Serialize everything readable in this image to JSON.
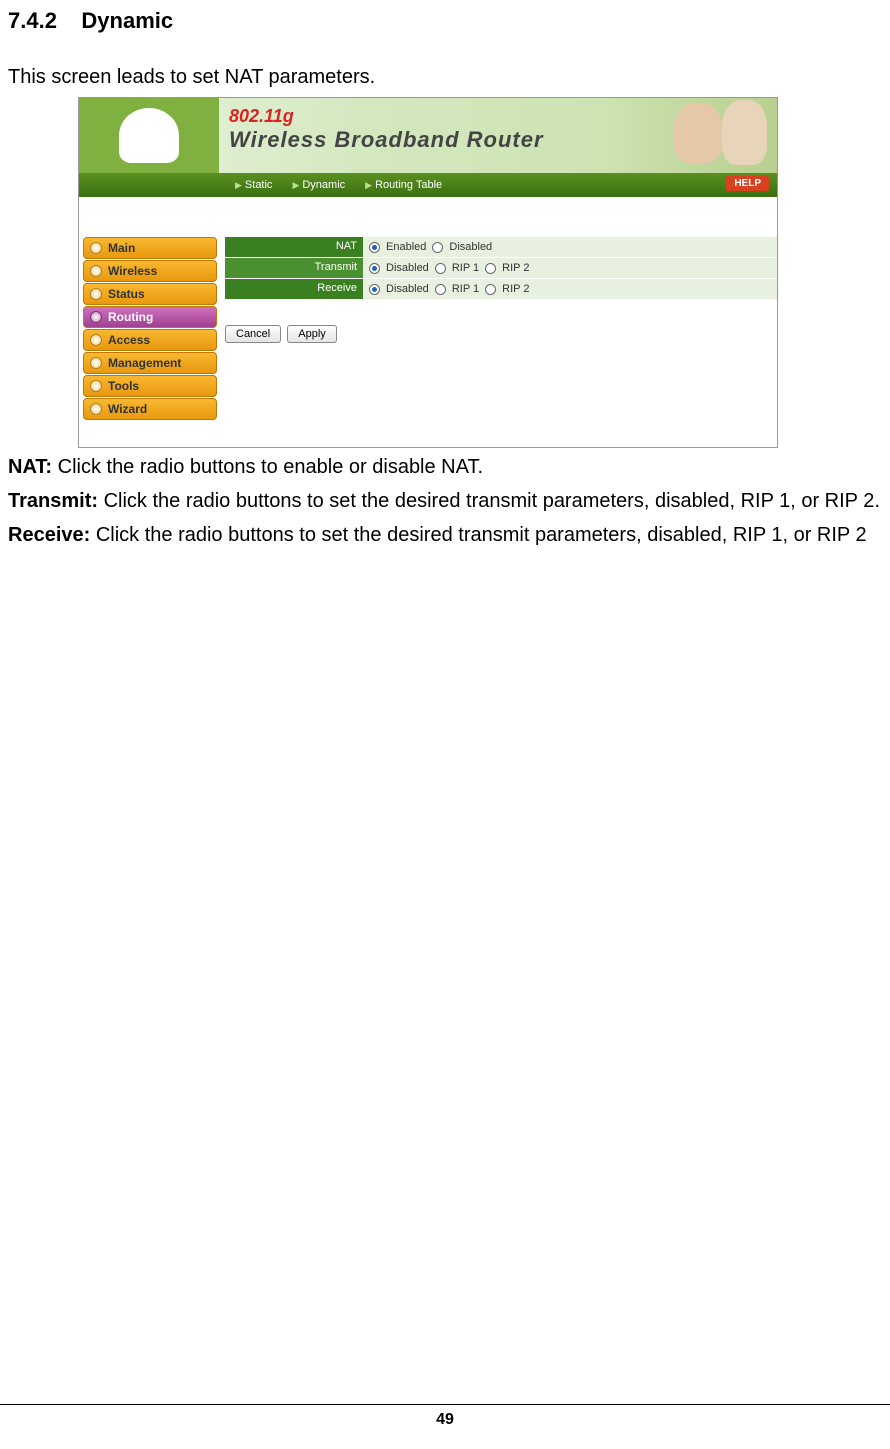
{
  "heading": {
    "number": "7.4.2",
    "title": "Dynamic"
  },
  "intro": "This screen leads to set NAT parameters.",
  "banner": {
    "logo": "802.11g",
    "title": "Wireless Broadband Router"
  },
  "subnav": {
    "items": [
      "Static",
      "Dynamic",
      "Routing Table"
    ],
    "help": "HELP"
  },
  "sidebar": {
    "items": [
      {
        "label": "Main",
        "active": false
      },
      {
        "label": "Wireless",
        "active": false
      },
      {
        "label": "Status",
        "active": false
      },
      {
        "label": "Routing",
        "active": true
      },
      {
        "label": "Access",
        "active": false
      },
      {
        "label": "Management",
        "active": false
      },
      {
        "label": "Tools",
        "active": false
      },
      {
        "label": "Wizard",
        "active": false
      }
    ]
  },
  "form": {
    "rows": [
      {
        "label": "NAT",
        "options": [
          "Enabled",
          "Disabled"
        ],
        "selected": 0
      },
      {
        "label": "Transmit",
        "options": [
          "Disabled",
          "RIP 1",
          "RIP 2"
        ],
        "selected": 0
      },
      {
        "label": "Receive",
        "options": [
          "Disabled",
          "RIP 1",
          "RIP 2"
        ],
        "selected": 0
      }
    ],
    "cancel": "Cancel",
    "apply": "Apply"
  },
  "descriptions": {
    "nat_label": "NAT:",
    "nat_text": " Click the radio buttons to enable or disable NAT.",
    "transmit_label": "Transmit:",
    "transmit_text": " Click the radio buttons to set the desired transmit parameters, disabled, RIP 1, or RIP 2.",
    "receive_label": "Receive:",
    "receive_text": " Click the radio buttons to set the desired transmit parameters, disabled, RIP 1, or RIP 2"
  },
  "page_number": "49"
}
